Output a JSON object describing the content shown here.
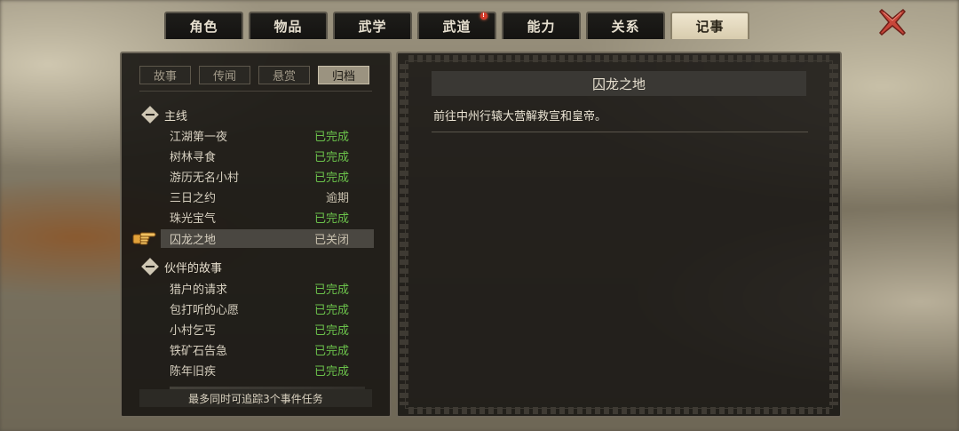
{
  "tabs": [
    {
      "label": "角色"
    },
    {
      "label": "物品"
    },
    {
      "label": "武学"
    },
    {
      "label": "武道",
      "badge": "!"
    },
    {
      "label": "能力"
    },
    {
      "label": "关系"
    },
    {
      "label": "记事",
      "active": true
    }
  ],
  "subtabs": [
    {
      "label": "故事"
    },
    {
      "label": "传闻"
    },
    {
      "label": "悬赏"
    },
    {
      "label": "归档",
      "active": true
    }
  ],
  "groups": [
    {
      "title": "主线",
      "quests": [
        {
          "name": "江湖第一夜",
          "status": "已完成"
        },
        {
          "name": "树林寻食",
          "status": "已完成"
        },
        {
          "name": "游历无名小村",
          "status": "已完成"
        },
        {
          "name": "三日之约",
          "status": "逾期"
        },
        {
          "name": "珠光宝气",
          "status": "已完成"
        },
        {
          "name": "囚龙之地",
          "status": "已关闭",
          "selected": true
        }
      ]
    },
    {
      "title": "伙伴的故事",
      "quests": [
        {
          "name": "猎户的请求",
          "status": "已完成"
        },
        {
          "name": "包打听的心愿",
          "status": "已完成"
        },
        {
          "name": "小村乞丐",
          "status": "已完成"
        },
        {
          "name": "铁矿石告急",
          "status": "已完成"
        },
        {
          "name": "陈年旧疾",
          "status": "已完成"
        }
      ]
    }
  ],
  "footer_note": "最多同时可追踪3个事件任务",
  "detail": {
    "title": "囚龙之地",
    "description": "前往中州行辕大营解救宣和皇帝。"
  },
  "icons": {
    "close": "close-x-icon",
    "collapse": "minus-diamond-icon",
    "pointer": "pointing-hand-icon",
    "badge": "red-alert-dot-icon"
  },
  "colors": {
    "status_done": "#6bc24b",
    "status_other": "#c9c1ae",
    "active_tab": "#e6dcc2",
    "close_red": "#c8463a"
  }
}
